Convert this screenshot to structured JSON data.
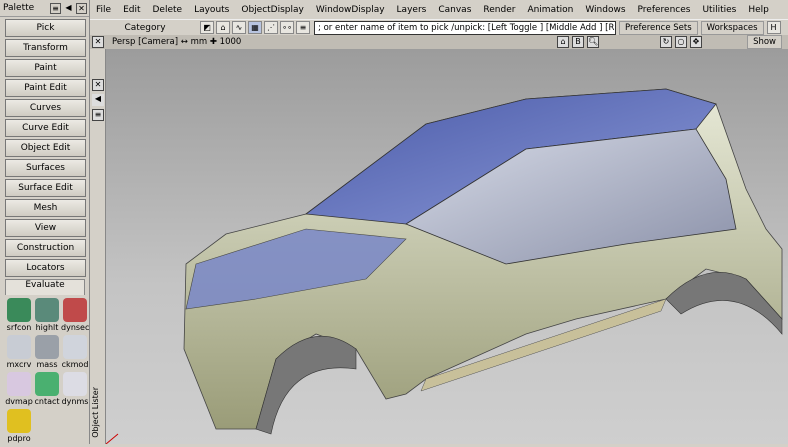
{
  "palette": {
    "title": "Palette",
    "buttons": [
      "Pick",
      "Transform",
      "Paint",
      "Paint Edit",
      "Curves",
      "Curve Edit",
      "Object Edit",
      "Surfaces",
      "Surface Edit",
      "Mesh",
      "View",
      "Construction",
      "Locators"
    ],
    "active_tab": "Evaluate",
    "tools": [
      {
        "label": "srfcon",
        "color": "#3a8a5a"
      },
      {
        "label": "highlt",
        "color": "#5a8a7a"
      },
      {
        "label": "dynsec",
        "color": "#c04a4a"
      },
      {
        "label": "mxcrv",
        "color": "#c8ccd4"
      },
      {
        "label": "mass",
        "color": "#9aa0a8"
      },
      {
        "label": "ckmod",
        "color": "#d0d4dc"
      },
      {
        "label": "dvmap",
        "color": "#d8c8e0"
      },
      {
        "label": "cntact",
        "color": "#4ab070"
      },
      {
        "label": "dynms",
        "color": "#dcdce4"
      },
      {
        "label": "pdpro",
        "color": "#e0c020"
      }
    ]
  },
  "menu": [
    "File",
    "Edit",
    "Delete",
    "Layouts",
    "ObjectDisplay",
    "WindowDisplay",
    "Layers",
    "Canvas",
    "Render",
    "Animation",
    "Windows",
    "Preferences",
    "Utilities",
    "Help"
  ],
  "toolbar": {
    "category": "Category",
    "pick_prompt": "; or enter name of item to pick /unpick: [Left Toggle ] [Middle Add ] [Right Unpick ]",
    "preference_sets": "Preference Sets",
    "workspaces": "Workspaces"
  },
  "viewport": {
    "title": "Persp [Camera] ↔ mm  ✚ 1000",
    "show": "Show"
  },
  "object_lister": "Object Lister"
}
